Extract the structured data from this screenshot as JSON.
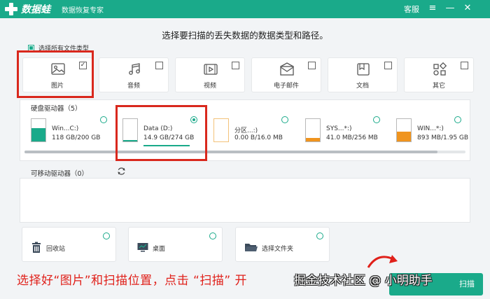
{
  "app": {
    "name": "数据蛙",
    "slogan": "数据恢复专家",
    "service_label": "客服",
    "min_label": "—",
    "menu_label": "≡",
    "close_label": "✕",
    "accent_color": "#1aaa8a",
    "highlight_color": "#d9281d"
  },
  "headline": "选择要扫描的丢失数据的数据类型和路径。",
  "select_all": {
    "label": "选择所有文件类型",
    "checked": true
  },
  "file_types": [
    {
      "label": "图片",
      "icon": "image-icon",
      "checked": true
    },
    {
      "label": "音频",
      "icon": "music-icon",
      "checked": false
    },
    {
      "label": "视频",
      "icon": "video-icon",
      "checked": false
    },
    {
      "label": "电子邮件",
      "icon": "mail-icon",
      "checked": false
    },
    {
      "label": "文档",
      "icon": "document-icon",
      "checked": false
    },
    {
      "label": "其它",
      "icon": "other-icon",
      "checked": false
    }
  ],
  "hard_drives": {
    "title": "硬盘驱动器（5）",
    "drives": [
      {
        "name": "Win...C:)",
        "size": "118 GB/200 GB",
        "selected": false,
        "used_fraction": 0.59,
        "fill_color": "#1aaa8a"
      },
      {
        "name": "Data (D:)",
        "size": "14.9 GB/274 GB",
        "selected": true,
        "used_fraction": 0.05,
        "fill_color": "#1aaa8a"
      },
      {
        "name": "分区...:)",
        "size": "0.00  B/16.0 MB",
        "selected": false,
        "used_fraction": 0.0,
        "fill_color": "#f5a623"
      },
      {
        "name": "SYS...*:)",
        "size": "41.0 MB/256 MB",
        "selected": false,
        "used_fraction": 0.16,
        "fill_color": "#f0941e"
      },
      {
        "name": "WIN...*:)",
        "size": "893 MB/1.95 GB",
        "selected": false,
        "used_fraction": 0.45,
        "fill_color": "#f0941e"
      }
    ]
  },
  "removable": {
    "title": "可移动驱动器（0）",
    "refresh_icon": "refresh-icon"
  },
  "locations": [
    {
      "label": "回收站",
      "icon": "trash-icon"
    },
    {
      "label": "桌面",
      "icon": "desktop-icon"
    },
    {
      "label": "选择文件夹",
      "icon": "folder-icon"
    }
  ],
  "scan_button": {
    "label": "扫描"
  },
  "caption": "选择好“图片”和扫描位置，点击 “扫描” 开",
  "watermark": "掘金技术社区 @ 小明助手"
}
